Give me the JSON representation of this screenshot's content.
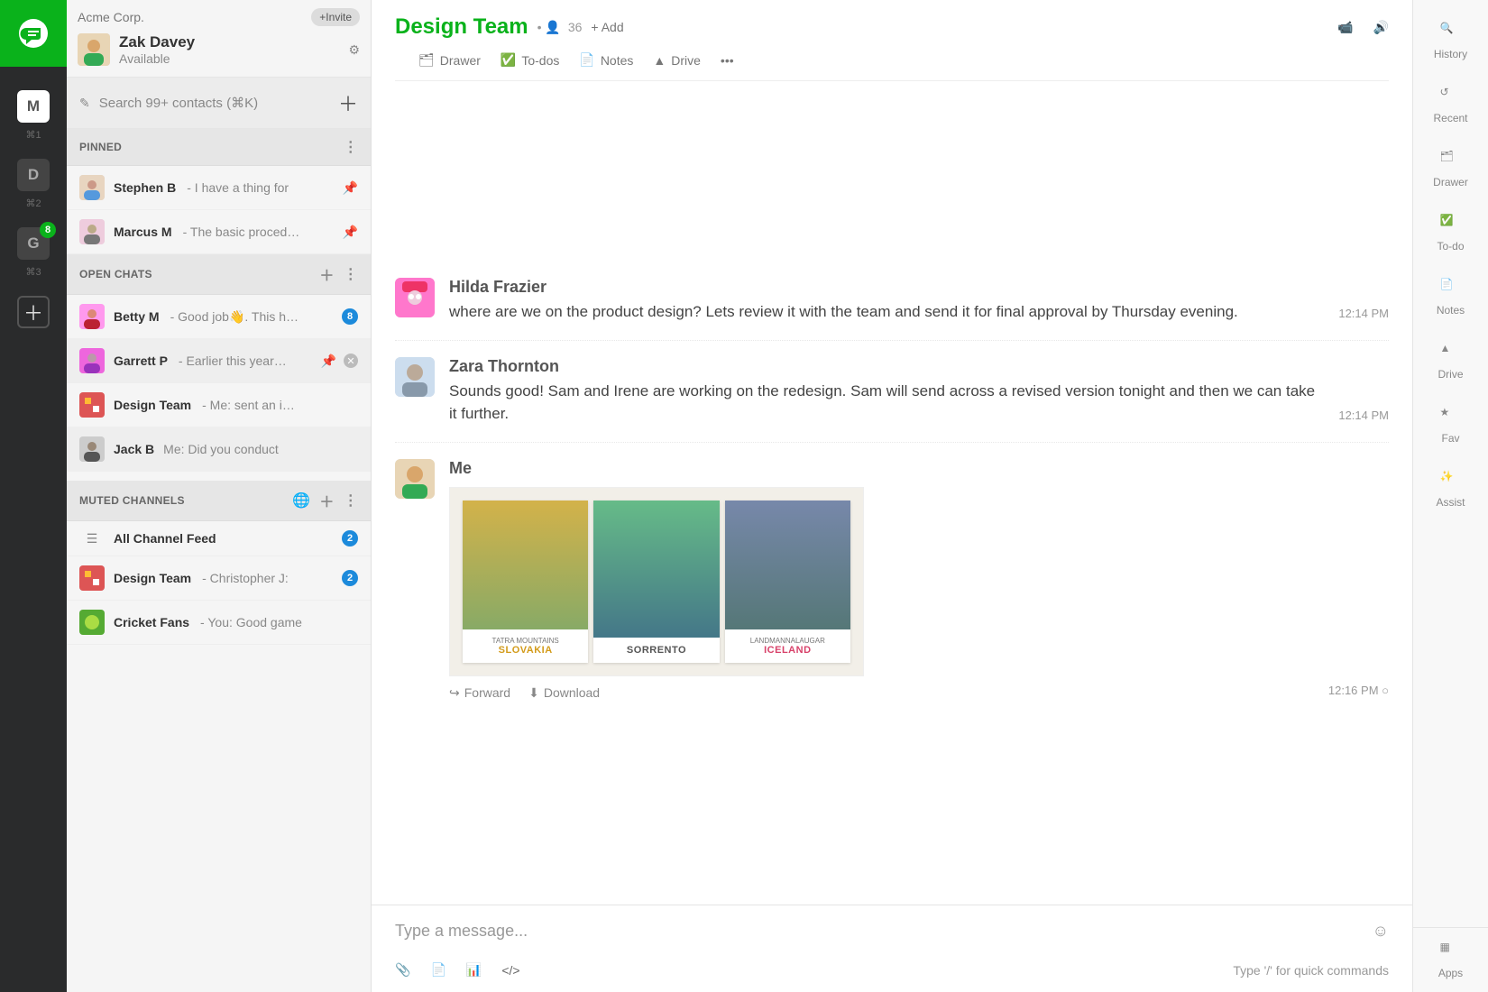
{
  "org": {
    "name": "Acme Corp.",
    "invite": "+Invite"
  },
  "profile": {
    "name": "Zak Davey",
    "status": "Available"
  },
  "search": {
    "placeholder": "Search 99+ contacts (⌘K)"
  },
  "rail": {
    "tiles": [
      {
        "letter": "M",
        "shortcut": "⌘1",
        "active": true
      },
      {
        "letter": "D",
        "shortcut": "⌘2",
        "active": false
      },
      {
        "letter": "G",
        "shortcut": "⌘3",
        "active": false,
        "badge": "8"
      }
    ]
  },
  "sections": {
    "pinned": {
      "title": "PINNED",
      "items": [
        {
          "name": "Stephen B",
          "preview": "I have a thing for"
        },
        {
          "name": "Marcus M",
          "preview": "The basic proced…"
        }
      ]
    },
    "open": {
      "title": "OPEN CHATS",
      "items": [
        {
          "name": "Betty M",
          "preview": "Good job👋. This h…",
          "badge": "8"
        },
        {
          "name": "Garrett P",
          "preview": "Earlier this year…",
          "pinned": true,
          "close": true
        },
        {
          "name": "Design Team",
          "preview": "Me: sent an i…"
        },
        {
          "name": "Jack B",
          "preview": "Me: Did you conduct"
        }
      ]
    },
    "muted": {
      "title": "MUTED CHANNELS",
      "items": [
        {
          "name": "All Channel Feed",
          "badge": "2",
          "icon": "feed"
        },
        {
          "name": "Design Team",
          "preview": "Christopher J:",
          "badge": "2"
        },
        {
          "name": "Cricket Fans",
          "preview": "You: Good game"
        }
      ]
    }
  },
  "channel": {
    "title": "Design Team",
    "members": "36",
    "add": "+ Add",
    "tabs": [
      {
        "label": "Drawer"
      },
      {
        "label": "To-dos"
      },
      {
        "label": "Notes"
      },
      {
        "label": "Drive"
      }
    ]
  },
  "messages": [
    {
      "author": "Hilda Frazier",
      "text": "where are we on the product design? Lets review it with the team and send it for final approval by Thursday evening.",
      "time": "12:14 PM",
      "avatar_bg": "#e8b"
    },
    {
      "author": "Zara Thornton",
      "text": "Sounds good! Sam and Irene are working on the redesign. Sam will send across a revised version tonight and then we can take it further.",
      "time": "12:14 PM",
      "avatar_bg": "#abc"
    },
    {
      "author": "Me",
      "time": "12:16 PM",
      "avatar_bg": "#d9c09a",
      "attachment": {
        "cards": [
          {
            "sub": "TATRA MOUNTAINS",
            "title": "SLOVAKIA"
          },
          {
            "sub": "",
            "title": "SORRENTO"
          },
          {
            "sub": "LANDMANNALAUGAR",
            "title": "ICELAND"
          }
        ],
        "forward": "Forward",
        "download": "Download"
      }
    }
  ],
  "composer": {
    "placeholder": "Type a message...",
    "hint": "Type '/' for quick commands"
  },
  "rightrail": [
    {
      "label": "History"
    },
    {
      "label": "Recent"
    },
    {
      "label": "Drawer"
    },
    {
      "label": "To-do"
    },
    {
      "label": "Notes"
    },
    {
      "label": "Drive"
    },
    {
      "label": "Fav"
    },
    {
      "label": "Assist"
    },
    {
      "label": "Apps"
    }
  ]
}
